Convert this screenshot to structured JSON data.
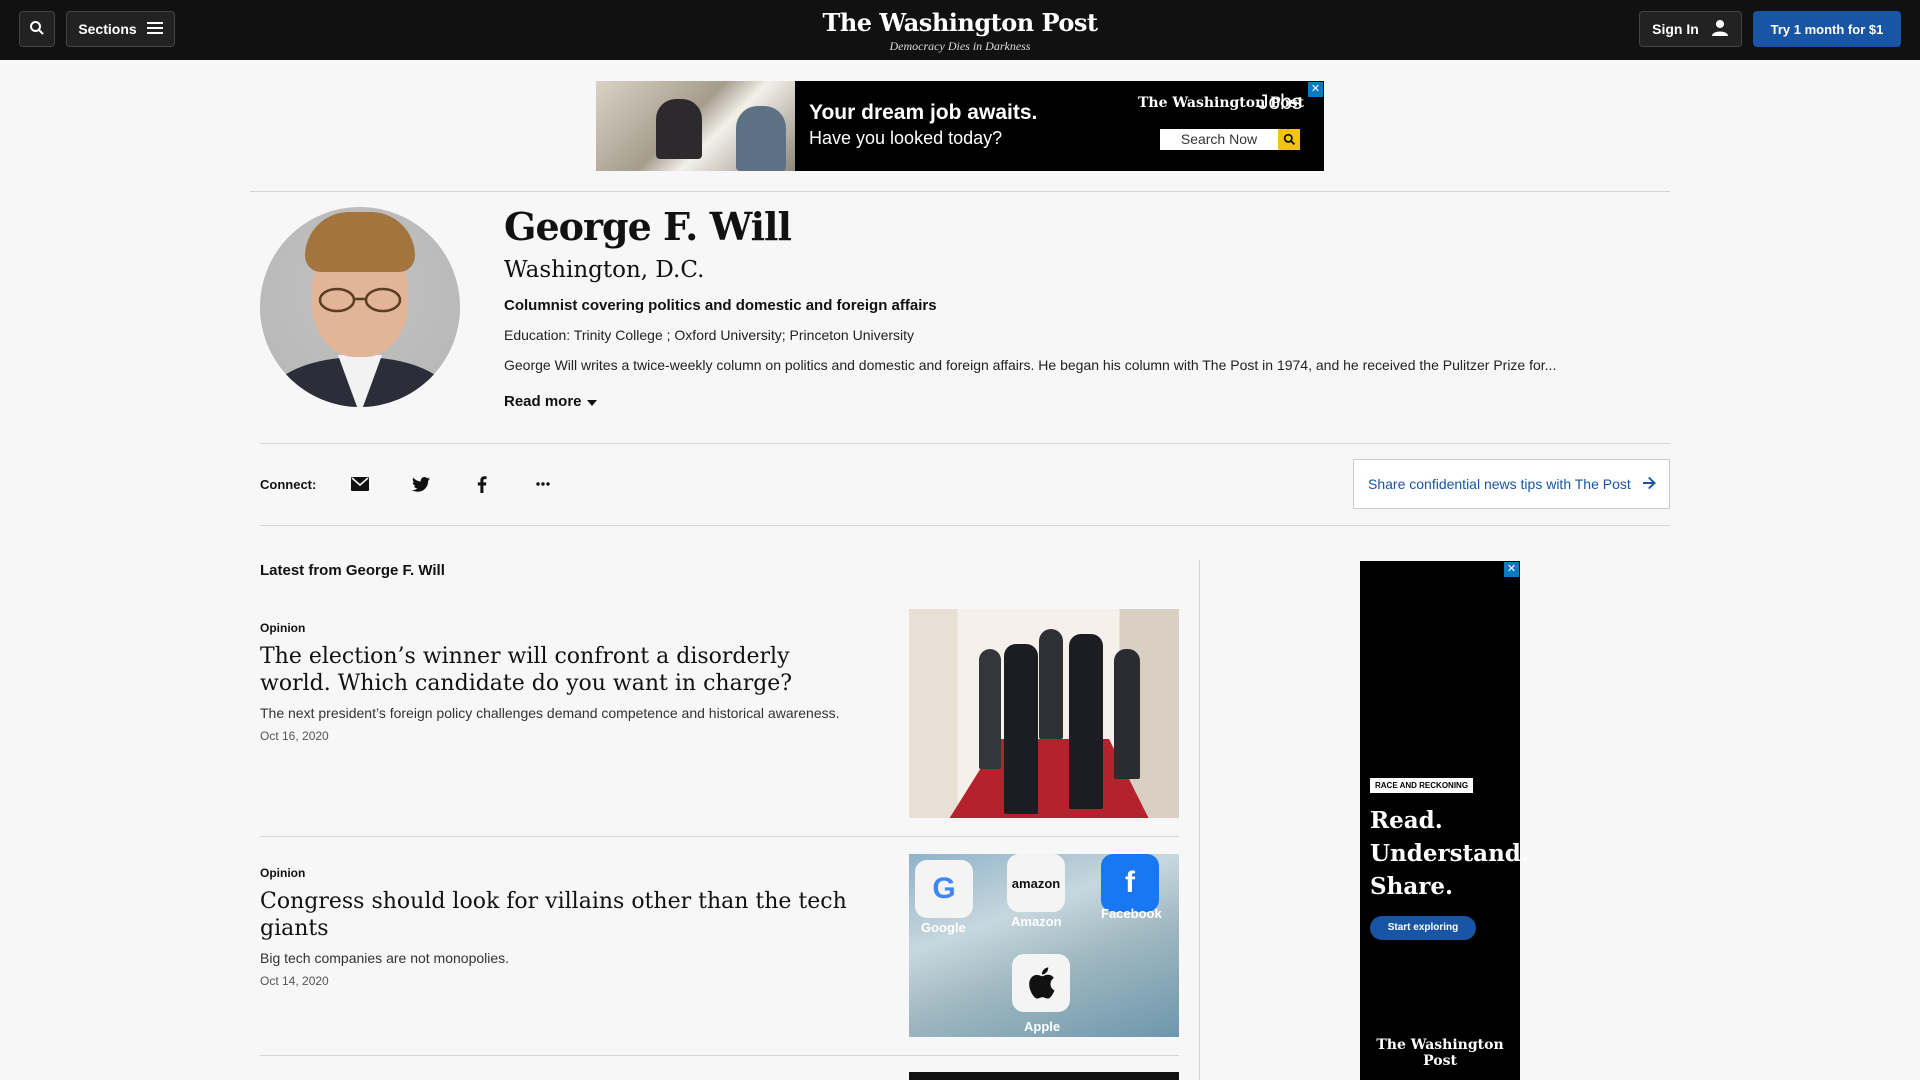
{
  "header": {
    "sections_label": "Sections",
    "logo_title": "The Washington Post",
    "logo_tagline": "Democracy Dies in Darkness",
    "signin_label": "Sign In",
    "subscribe_label": "Try 1 month for $1"
  },
  "ad_banner": {
    "headline": "Your dream job awaits.",
    "subline": "Have you looked today?",
    "brand": "The Washington Post",
    "brand_suffix": "Jobs",
    "search_label": "Search Now",
    "close_label": "✕"
  },
  "author": {
    "name": "George F. Will",
    "location": "Washington, D.C.",
    "role": "Columnist covering politics and domestic and foreign affairs",
    "education": "Education: Trinity College ; Oxford University; Princeton University",
    "bio": "George Will writes a twice-weekly column on politics and domestic and foreign affairs. He began his column with The Post in 1974, and he received the Pulitzer Prize for...",
    "read_more": "Read more"
  },
  "connect": {
    "label": "Connect:",
    "icons": [
      "email-icon",
      "twitter-icon",
      "facebook-icon",
      "more-icon"
    ],
    "tips_label": "Share confidential news tips with The Post"
  },
  "latest": {
    "heading": "Latest from George F. Will",
    "articles": [
      {
        "kicker": "Opinion",
        "title": "The election’s winner will confront a disorderly world. Which candidate do you want in charge?",
        "dek": "The next president’s foreign policy challenges demand competence and historical awareness.",
        "date": "Oct 16, 2020"
      },
      {
        "kicker": "Opinion",
        "title": "Congress should look for villains other than the tech giants",
        "dek": "Big tech companies are not monopolies.",
        "date": "Oct 14, 2020",
        "image_labels": [
          "Google",
          "Amazon",
          "Facebook",
          "Apple"
        ],
        "image_tile_texts": [
          "G",
          "amazon",
          "f",
          ""
        ]
      }
    ]
  },
  "side_ad": {
    "tag": "RACE AND RECKONING",
    "headline_lines": [
      "Read.",
      "Understand.",
      "Share."
    ],
    "button": "Start exploring",
    "logo": "The Washington Post",
    "close_label": "✕"
  },
  "colors": {
    "topbar": "#111111",
    "accent_blue": "#1955a5",
    "page_bg": "#f7f7f7"
  }
}
